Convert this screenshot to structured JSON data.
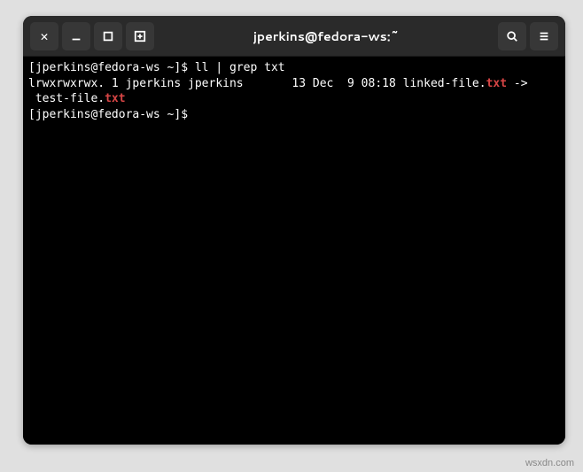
{
  "window": {
    "title": "jperkins@fedora-ws:~"
  },
  "terminal": {
    "prompt1_open": "[",
    "prompt1_userhost": "jperkins@fedora-ws ~",
    "prompt1_close": "]$",
    "cmd1": " ll | grep txt",
    "out_line1_a": "lrwxrwxrwx. 1 jperkins jperkins       13 Dec  9 08:18 linked-file.",
    "out_line1_hl": "txt",
    "out_line1_b": " ->",
    "out_line2_a": " test-file.",
    "out_line2_hl": "txt",
    "prompt2_open": "[",
    "prompt2_userhost": "jperkins@fedora-ws ~",
    "prompt2_close": "]$",
    "cmd2": " "
  },
  "watermark": "wsxdn.com"
}
